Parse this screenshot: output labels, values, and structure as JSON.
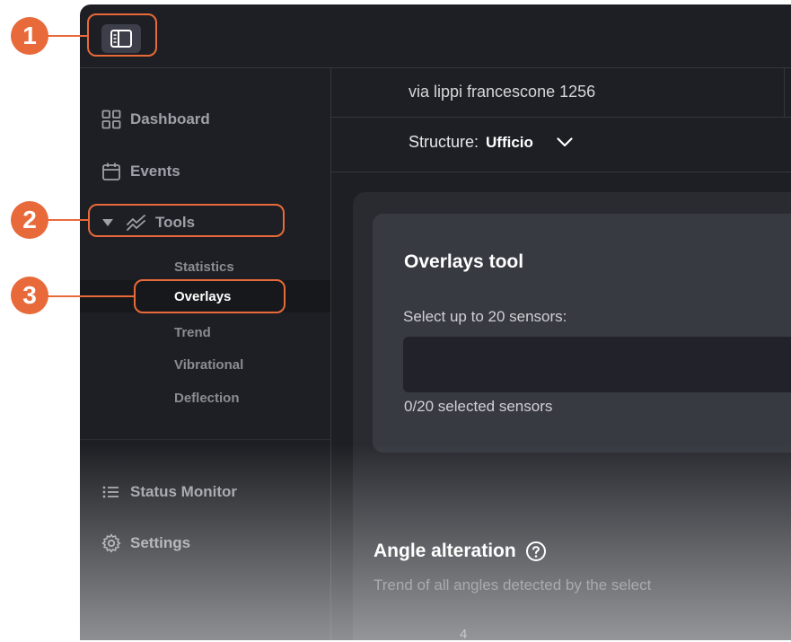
{
  "colors": {
    "background": "#1e1f24",
    "card": "#383a42",
    "annotation": "#e86a3a",
    "active_text": "#ffffff",
    "muted_text": "#9fa0a8"
  },
  "annotations": [
    "1",
    "2",
    "3"
  ],
  "topbar": {
    "toggle_icon": "sidebar-toggle-icon"
  },
  "sidebar": {
    "dashboard": {
      "label": "Dashboard",
      "icon": "grid-icon"
    },
    "events": {
      "label": "Events",
      "icon": "calendar-icon"
    },
    "tools": {
      "label": "Tools",
      "icon": "trend-lines-icon",
      "expanded": true,
      "items": [
        {
          "label": "Statistics"
        },
        {
          "label": "Overlays",
          "active": true
        },
        {
          "label": "Trend"
        },
        {
          "label": "Vibrational"
        },
        {
          "label": "Deflection"
        }
      ]
    },
    "status_monitor": {
      "label": "Status Monitor",
      "icon": "list-icon"
    },
    "settings": {
      "label": "Settings",
      "icon": "gear-icon"
    }
  },
  "header": {
    "address": "via lippi francescone 1256",
    "structure_label": "Structure:",
    "structure_value": "Ufficio"
  },
  "overlays": {
    "title": "Overlays tool",
    "select_label": "Select up to 20 sensors:",
    "sensor_input_value": "",
    "selected_count": "0/20 selected sensors"
  },
  "angle": {
    "title": "Angle alteration",
    "description": "Trend of all angles detected by the select",
    "axis_tick": "4"
  }
}
